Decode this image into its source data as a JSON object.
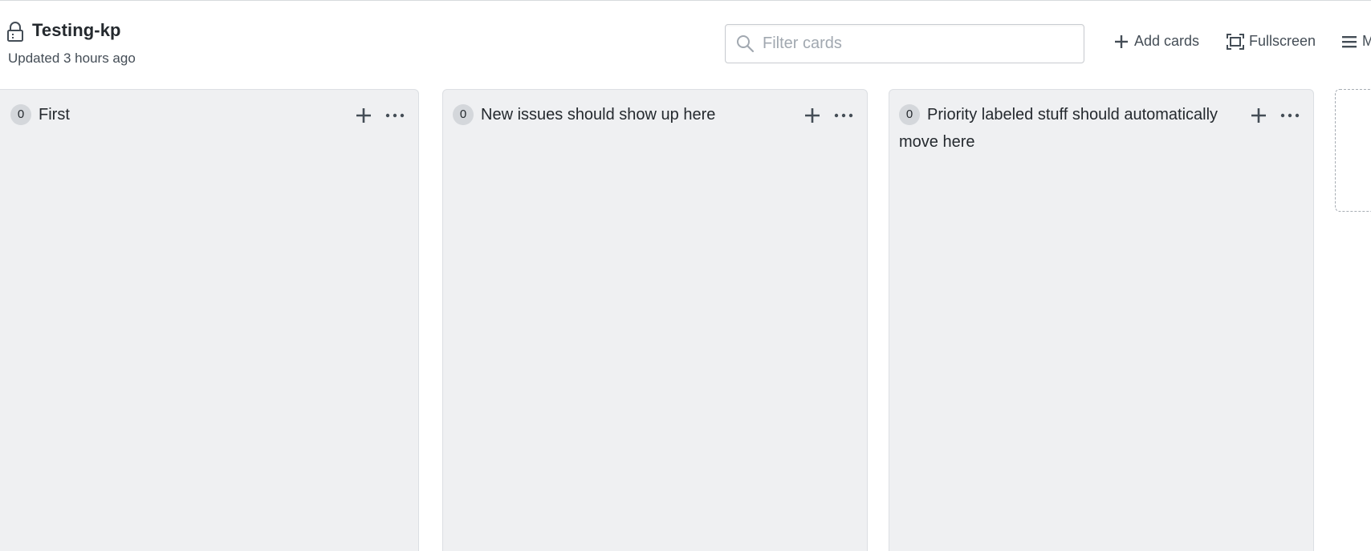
{
  "board": {
    "title": "Testing-kp",
    "updated": "Updated 3 hours ago"
  },
  "toolbar": {
    "filter_placeholder": "Filter cards",
    "filter_value": "",
    "add_cards_label": "Add cards",
    "fullscreen_label": "Fullscreen",
    "menu_label": "M"
  },
  "columns": [
    {
      "count": "0",
      "title": "First"
    },
    {
      "count": "0",
      "title": "New issues should show up here"
    },
    {
      "count": "0",
      "title": "Priority labeled stuff should automatically move here"
    }
  ],
  "icons": {
    "lock": "lock-icon",
    "search": "search-icon",
    "plus": "plus-icon",
    "fullscreen": "fullscreen-icon",
    "menu": "hamburger-menu-icon",
    "more": "ellipsis-icon"
  },
  "colors": {
    "column_bg": "#eff0f2",
    "text": "#24292e",
    "muted": "#444d56",
    "badge_bg": "#d4d7db"
  }
}
